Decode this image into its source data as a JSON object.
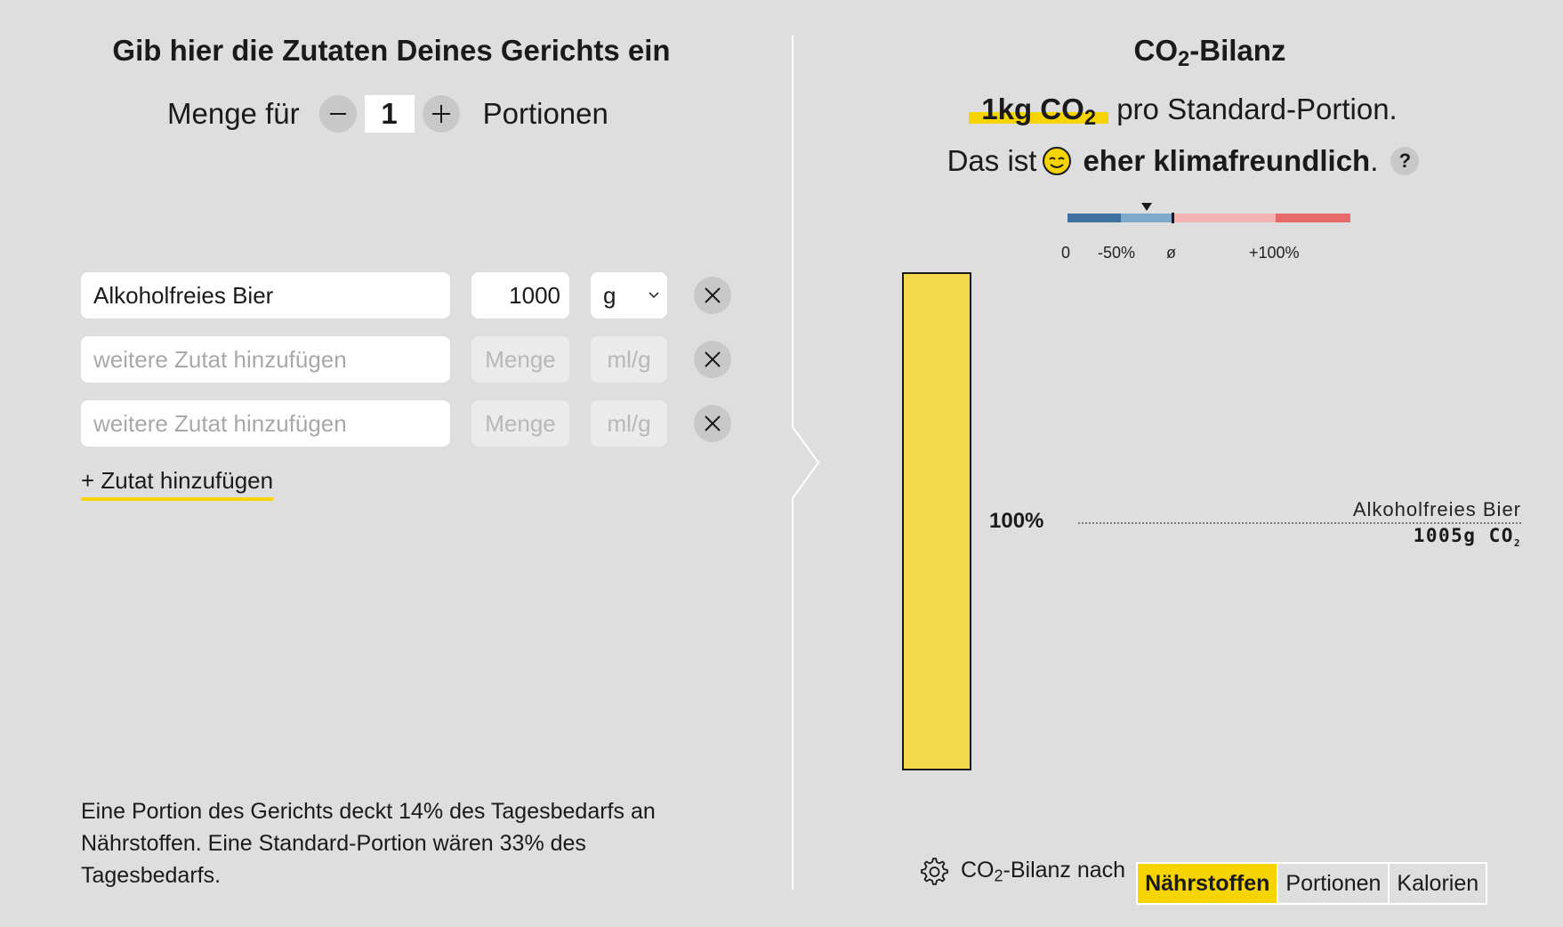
{
  "left": {
    "title": "Gib hier die Zutaten Deines Gerichts ein",
    "portions": {
      "label_before": "Menge für",
      "minus": "−",
      "value": "1",
      "plus": "+",
      "label_after": "Portionen"
    },
    "ingredients": [
      {
        "name": "Alkoholfreies Bier",
        "amount": "1000",
        "unit": "g"
      }
    ],
    "empty_rows": [
      {
        "name_placeholder": "weitere Zutat hinzufügen",
        "amount_placeholder": "Menge",
        "unit_placeholder": "ml/g"
      },
      {
        "name_placeholder": "weitere Zutat hinzufügen",
        "amount_placeholder": "Menge",
        "unit_placeholder": "ml/g"
      }
    ],
    "add_link": "+ Zutat hinzufügen",
    "nutrition_text": "Eine Portion des Gerichts deckt 14% des Tagesbedarfs an Nährstoffen. Eine Standard-Portion wären 33% des Tagesbedarfs."
  },
  "right": {
    "title_prefix": "CO",
    "title_sub": "2",
    "title_suffix": "-Bilanz",
    "summary": {
      "amount": "1kg CO",
      "amount_sub": "2",
      "text": "pro Standard-Portion."
    },
    "rating": {
      "prefix": "Das ist",
      "bold": "eher klimafreundlich",
      "suffix": ".",
      "help": "?",
      "marker_fraction": 0.28
    },
    "scale": {
      "labels": [
        "0",
        "-50%",
        "ø",
        "+100%"
      ],
      "colors": [
        "#3f72a0",
        "#7fa9cb",
        "#f4b3b3",
        "#e66a6a"
      ]
    },
    "bottom": {
      "label_prefix": "CO",
      "label_sub": "2",
      "label_suffix": "-Bilanz nach",
      "options": [
        "Nährstoffen",
        "Portionen",
        "Kalorien"
      ],
      "active": "Nährstoffen"
    },
    "colors": {
      "accent": "#f5d400",
      "bar": "#f2d84a"
    }
  },
  "chart_data": {
    "type": "bar",
    "categories": [
      "Alkoholfreies Bier"
    ],
    "values": [
      1005
    ],
    "share_percent": [
      100
    ],
    "percent_label": "100%",
    "value_label": "1005g CO",
    "value_label_sub": "2",
    "ylabel": ""
  }
}
